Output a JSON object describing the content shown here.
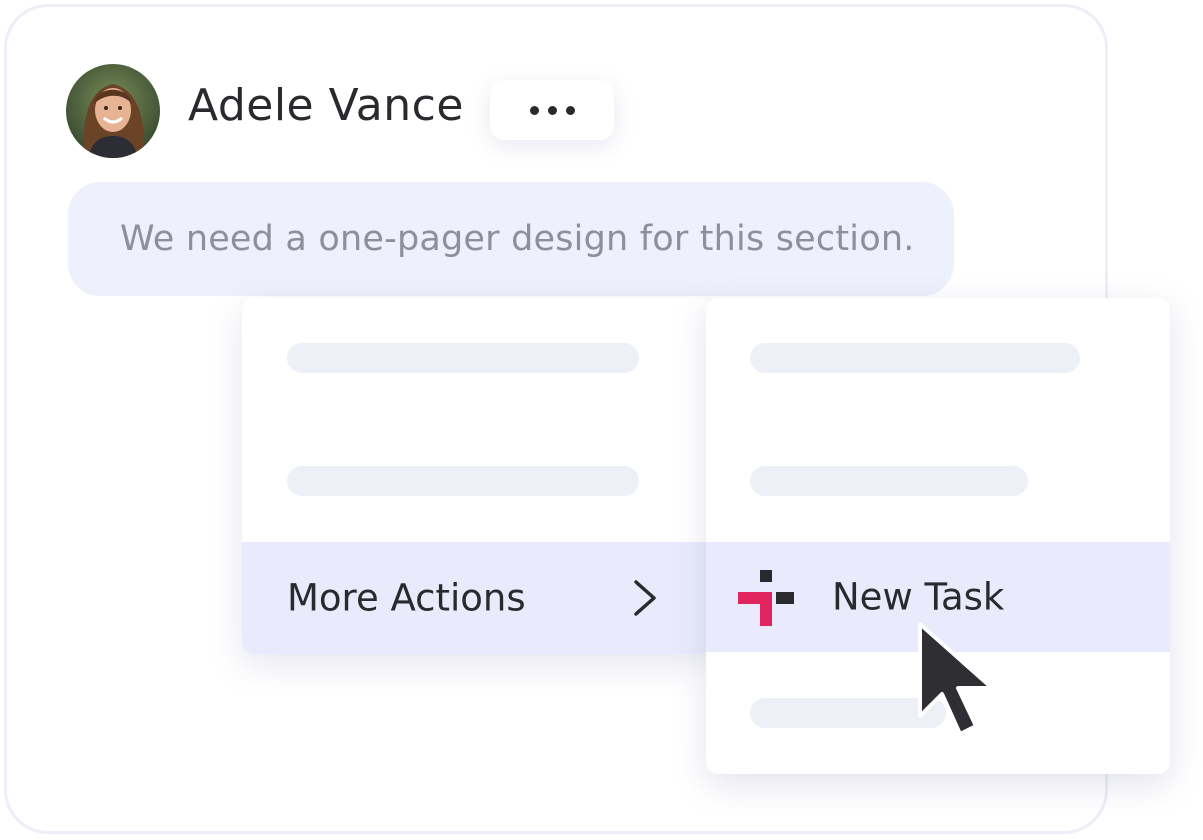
{
  "header": {
    "user_name": "Adele Vance",
    "more_options_icon": "more-horizontal-icon"
  },
  "message": {
    "text": "We need a one-pager design for this section."
  },
  "context_menu": {
    "items": [
      {
        "label": "",
        "placeholder": true
      },
      {
        "label": "",
        "placeholder": true
      },
      {
        "label": "More Actions",
        "placeholder": false,
        "highlighted": true,
        "icon": "chevron-right-icon"
      }
    ]
  },
  "submenu": {
    "items": [
      {
        "label": "",
        "placeholder": true
      },
      {
        "label": "",
        "placeholder": true
      },
      {
        "label": "New Task",
        "placeholder": false,
        "highlighted": true,
        "icon": "new-task-icon"
      },
      {
        "label": "",
        "placeholder": true
      }
    ]
  },
  "colors": {
    "highlight": "#e9ebfc",
    "bubble": "#eef0fb",
    "accent_red": "#e0245e",
    "text_dark": "#2a2a2e",
    "text_muted": "#8d8f9e"
  }
}
